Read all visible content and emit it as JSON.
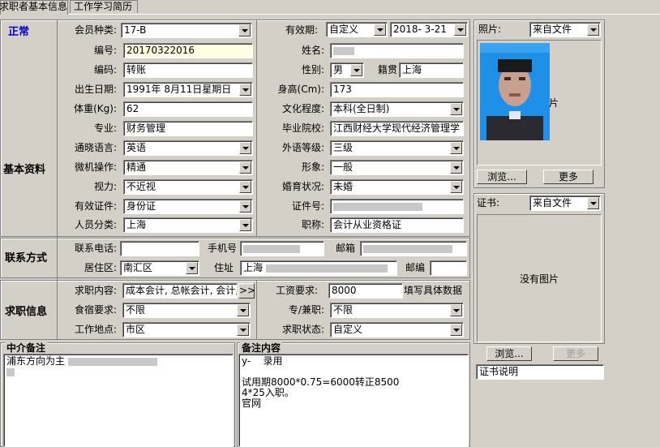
{
  "tabs": [
    "求职者基本信息",
    "工作学习简历"
  ],
  "status_text": "正常",
  "sections": {
    "basic": "基本资料",
    "contact": "联系方式",
    "jobseek": "求职信息",
    "agency_note": "中介备注",
    "remark": "备注内容"
  },
  "fields": {
    "member_type": {
      "label": "会员种类:",
      "value": "17-B"
    },
    "validity": {
      "label": "有效期:",
      "mode": "自定义",
      "date": "2018- 3-21"
    },
    "number": {
      "label": "编号:",
      "value": "20170322016"
    },
    "name": {
      "label": "姓名:",
      "value": ""
    },
    "code": {
      "label": "编码:",
      "value": "转账"
    },
    "gender": {
      "label": "性别:",
      "value": "男"
    },
    "native": {
      "label": "籍贯",
      "value": "上海"
    },
    "birth": {
      "label": "出生日期:",
      "value": "1991年 8月11日星期日"
    },
    "height": {
      "label": "身高(Cm):",
      "value": "173"
    },
    "weight": {
      "label": "体重(Kg):",
      "value": "62"
    },
    "education": {
      "label": "文化程度:",
      "value": "本科(全日制)"
    },
    "major": {
      "label": "专业:",
      "value": "财务管理"
    },
    "school": {
      "label": "毕业院校:",
      "value": "江西财经大学现代经济管理学"
    },
    "language": {
      "label": "通晓语言:",
      "value": "英语"
    },
    "lang_level": {
      "label": "外语等级:",
      "value": "三级"
    },
    "computer": {
      "label": "微机操作:",
      "value": "精通"
    },
    "appearance": {
      "label": "形象:",
      "value": "一般"
    },
    "vision": {
      "label": "视力:",
      "value": "不近视"
    },
    "marital": {
      "label": "婚育状况:",
      "value": "未婚"
    },
    "id_type": {
      "label": "有效证件:",
      "value": "身份证"
    },
    "id_no": {
      "label": "证件号:",
      "value": ""
    },
    "person_cat": {
      "label": "人员分类:",
      "value": "上海"
    },
    "title": {
      "label": "职称:",
      "value": "会计从业资格证"
    },
    "phone": {
      "label": "联系电话:",
      "value": ""
    },
    "mobile": {
      "label": "手机号",
      "value": ""
    },
    "email": {
      "label": "邮箱",
      "value": ""
    },
    "district": {
      "label": "居住区:",
      "value": "南汇区"
    },
    "address": {
      "label": "住址",
      "value": "上海"
    },
    "zip": {
      "label": "邮编",
      "value": ""
    },
    "job_content": {
      "label": "求职内容:",
      "value": "成本会计, 总帐会计, 会计,",
      "more": ">>"
    },
    "salary": {
      "label": "工资要求:",
      "value": "8000",
      "hint": "填写具体数据"
    },
    "board": {
      "label": "食宿要求:",
      "value": "不限"
    },
    "fulltime": {
      "label": "专/兼职:",
      "value": "不限"
    },
    "location": {
      "label": "工作地点:",
      "value": "市区"
    },
    "job_status": {
      "label": "求职状态:",
      "value": "自定义"
    }
  },
  "photo": {
    "label": "照片:",
    "source": "来自文件",
    "caption": "片",
    "browse": "浏览...",
    "more": "更多"
  },
  "cert": {
    "label": "证书:",
    "source": "来自文件",
    "empty": "没有图片",
    "browse": "浏览...",
    "more": "更多",
    "desc": "证书说明"
  },
  "agency_note_text": "浦东方向为主",
  "remark_text": "y-    录用\n\n试用期8000*0.75=6000转正8500\n4*25入职。\n官网"
}
